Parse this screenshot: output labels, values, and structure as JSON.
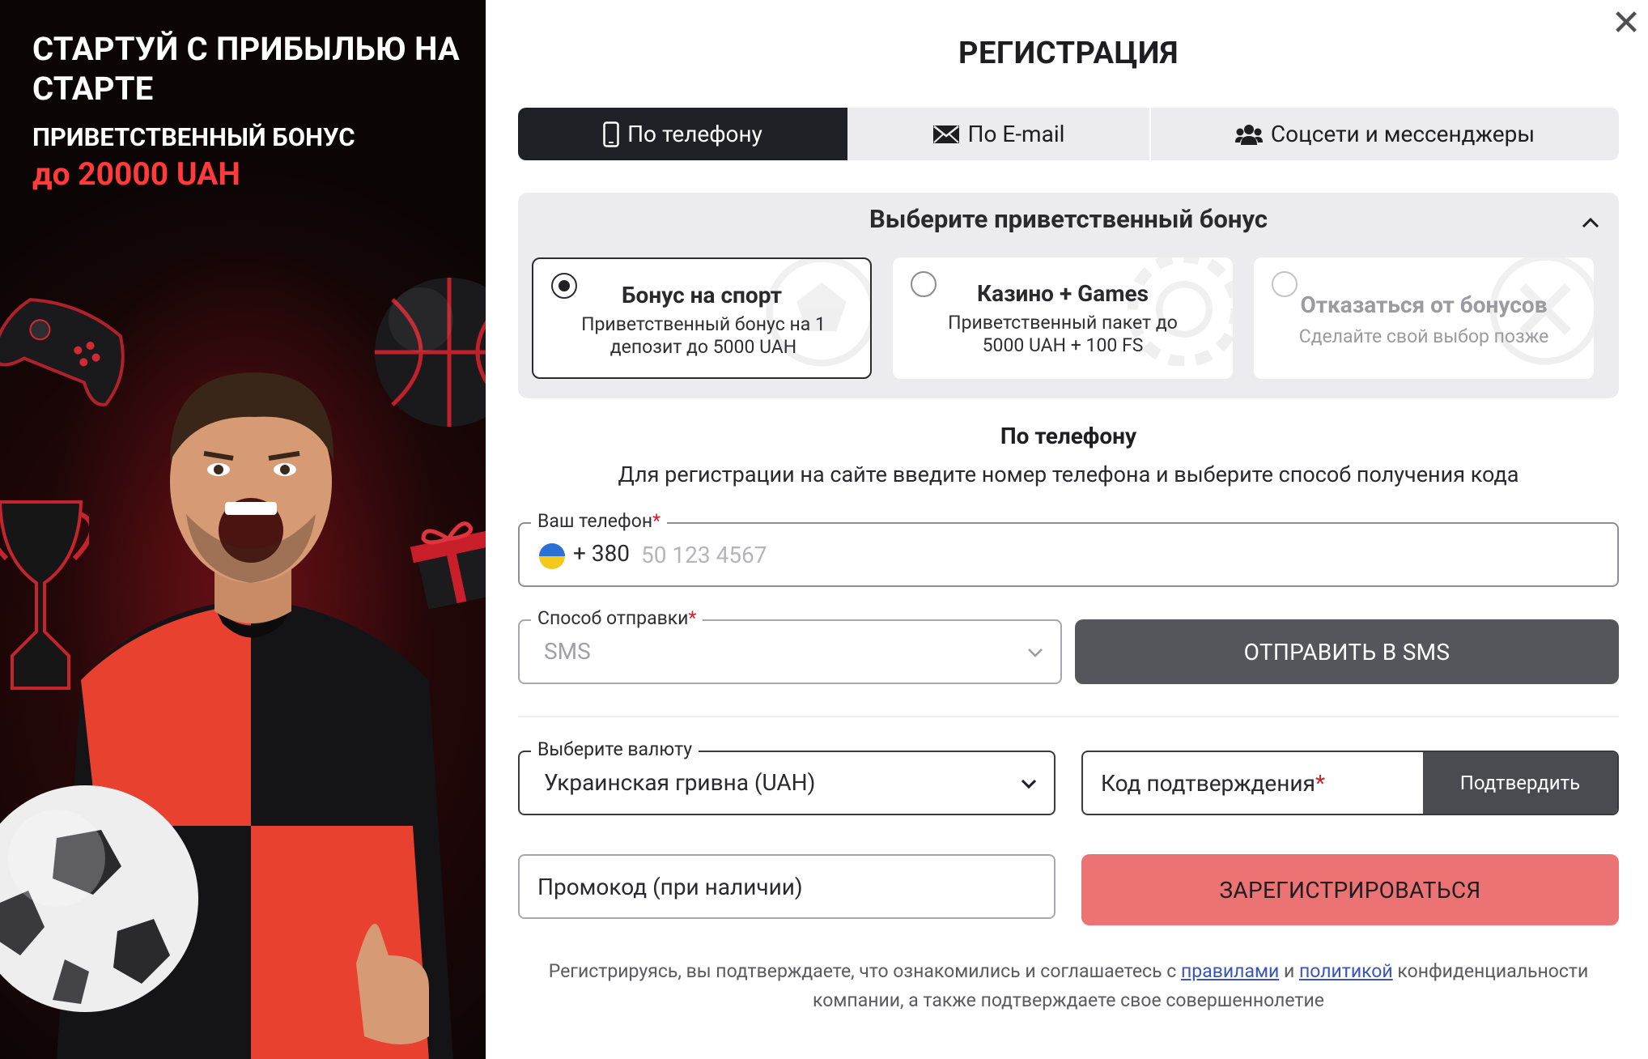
{
  "promo": {
    "title": "СТАРТУЙ С ПРИБЫЛЬЮ НА СТАРТЕ",
    "subtitle": "ПРИВЕТСТВЕННЫЙ БОНУС",
    "amount": "до 20000 UAH"
  },
  "close": {
    "label": "✕",
    "icon": "close-icon"
  },
  "form": {
    "title": "РЕГИСТРАЦИЯ",
    "tabs": [
      {
        "label": "По телефону",
        "icon": "phone-icon",
        "active": true
      },
      {
        "label": "По E-mail",
        "icon": "envelope-icon",
        "active": false
      },
      {
        "label": "Соцсети и мессенджеры",
        "icon": "users-icon",
        "active": false
      }
    ],
    "bonus": {
      "heading": "Выберите приветственный бонус",
      "options": [
        {
          "title": "Бонус на спорт",
          "description": "Приветственный бонус на 1 депозит до 5000 UAH",
          "selected": true
        },
        {
          "title": "Казино + Games",
          "description": "Приветственный пакет до 5000 UAH + 100 FS",
          "selected": false
        },
        {
          "title": "Отказаться от бонусов",
          "description": "Сделайте свой выбор позже",
          "selected": false
        }
      ]
    },
    "section_title": "По телефону",
    "section_description": "Для регистрации на сайте введите номер телефона и выберите способ получения кода",
    "phone": {
      "label": "Ваш телефон",
      "required_mark": "*",
      "code": "+ 380",
      "placeholder": "50 123 4567",
      "value": ""
    },
    "send_method": {
      "label": "Способ отправки",
      "required_mark": "*",
      "value": "SMS"
    },
    "send_button": "ОТПРАВИТЬ В SMS",
    "currency": {
      "label": "Выберите валюту",
      "value": "Украинская гривна (UAH)"
    },
    "confirmation": {
      "label": "Код подтверждения",
      "required_mark": "*",
      "button": "Подтвердить"
    },
    "promocode": {
      "label": "Промокод (при наличии)"
    },
    "register_button": "ЗАРЕГИСТРИРОВАТЬСЯ",
    "terms": {
      "before": "Регистрируясь, вы подтверждаете, что ознакомились и соглашаетесь с ",
      "rules_link": "правилами",
      "middle": " и ",
      "policy_link": "политикой",
      "after": " конфиденциальности компании, а также подтверждаете свое совершеннолетие"
    }
  },
  "colors": {
    "dark_tab": "#202126",
    "send_button": "#55565c",
    "register_button": "#ec7373",
    "accent_red": "#ff3b3b",
    "link": "#3a55b8"
  }
}
